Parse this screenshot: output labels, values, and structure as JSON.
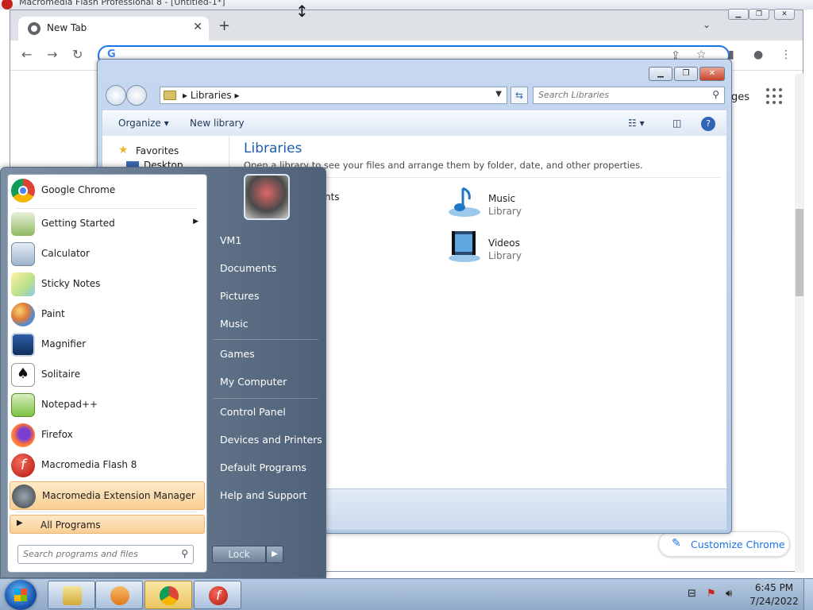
{
  "flash_window": {
    "title": "Macromedia Flash Professional 8 - [Untitled-1*]"
  },
  "chrome": {
    "tab_title": "New Tab",
    "omnibox_glyph": "G",
    "apps_fragment": "ges",
    "customize_label": "Customize Chrome"
  },
  "libraries": {
    "breadcrumb": "Libraries",
    "search_placeholder": "Search Libraries",
    "toolbar": {
      "organize": "Organize",
      "new_library": "New library"
    },
    "nav": {
      "favorites": "Favorites",
      "desktop": "Desktop"
    },
    "heading": "Libraries",
    "subtitle": "Open a library to see your files and arrange them by folder, date, and other properties.",
    "partial_item": "nts",
    "items": [
      {
        "name": "Music",
        "type": "Library"
      },
      {
        "name": "Videos",
        "type": "Library"
      }
    ]
  },
  "start_menu": {
    "programs": [
      {
        "label": "Google Chrome",
        "icon": "chrome-icon"
      },
      {
        "label": "Getting Started",
        "icon": "getting-started-icon",
        "submenu": true
      },
      {
        "label": "Calculator",
        "icon": "calculator-icon"
      },
      {
        "label": "Sticky Notes",
        "icon": "sticky-notes-icon"
      },
      {
        "label": "Paint",
        "icon": "paint-icon"
      },
      {
        "label": "Magnifier",
        "icon": "magnifier-icon"
      },
      {
        "label": "Solitaire",
        "icon": "solitaire-icon"
      },
      {
        "label": "Notepad++",
        "icon": "notepad-plus-plus-icon"
      },
      {
        "label": "Firefox",
        "icon": "firefox-icon"
      },
      {
        "label": "Macromedia Flash 8",
        "icon": "flash-icon"
      },
      {
        "label": "Macromedia Extension Manager",
        "icon": "extension-manager-icon",
        "highlighted": true
      }
    ],
    "all_programs": "All Programs",
    "search_placeholder": "Search programs and files",
    "right_items": [
      "VM1",
      "Documents",
      "Pictures",
      "Music",
      "Games",
      "My Computer",
      "Control Panel",
      "Devices and Printers",
      "Default Programs",
      "Help and Support"
    ],
    "lock_label": "Lock"
  },
  "taskbar": {
    "time": "6:45 PM",
    "date": "7/24/2022"
  },
  "colors": {
    "chrome_accent": "#1a73e8",
    "libraries_heading": "#1e5fa8",
    "start_highlight": "#f9cf94"
  }
}
